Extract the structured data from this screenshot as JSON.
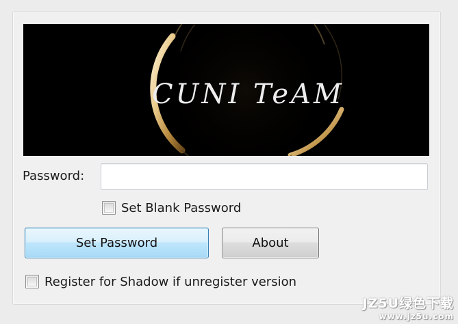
{
  "banner": {
    "text": "CUNI TeAM"
  },
  "password": {
    "label": "Password:",
    "value": "",
    "placeholder": ""
  },
  "blank_password": {
    "label": "Set Blank Password",
    "checked": false
  },
  "buttons": {
    "set_password": "Set Password",
    "about": "About"
  },
  "register_shadow": {
    "label": "Register for Shadow if unregister version",
    "checked": false
  },
  "watermark": {
    "line1": "JZ5U绿色下载",
    "line2": "www.jz5u.com"
  },
  "colors": {
    "primary_button_border": "#3c7fb1",
    "primary_button_fill": "#bee6fd",
    "banner_background": "#000000",
    "ring_gold": "#e8c98a"
  }
}
